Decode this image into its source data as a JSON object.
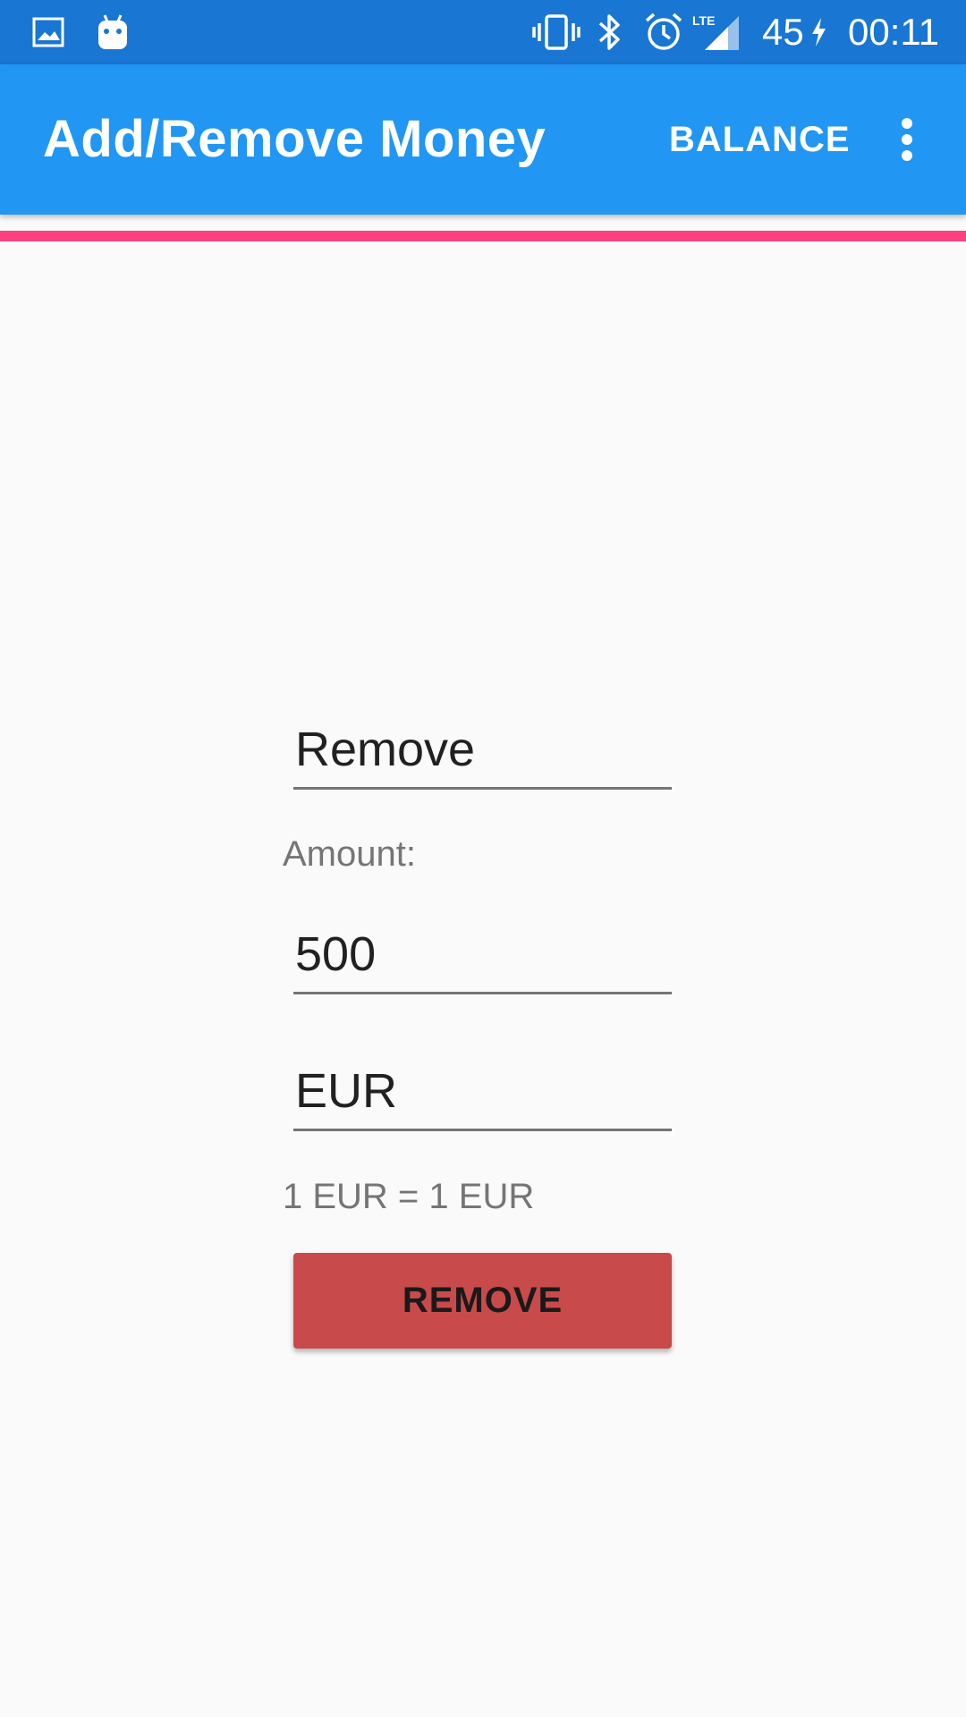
{
  "status_bar": {
    "icons": [
      "image-icon",
      "android-icon",
      "vibrate-icon",
      "bluetooth-icon",
      "alarm-icon",
      "lte-signal-icon",
      "charging-icon"
    ],
    "network_label": "LTE",
    "battery": "45",
    "time": "00:11"
  },
  "app_bar": {
    "title": "Add/Remove Money",
    "balance_label": "BALANCE",
    "overflow_icon": "more-vert-icon"
  },
  "colors": {
    "status_bar": "#1976d2",
    "app_bar": "#2196f3",
    "accent": "#ff4081",
    "remove_button": "#c94a4a",
    "background": "#fafafa"
  },
  "form": {
    "operation_value": "Remove",
    "amount_label": "Amount:",
    "amount_value": "500",
    "currency_value": "EUR",
    "rate_text": "1 EUR = 1 EUR",
    "submit_label": "REMOVE"
  }
}
